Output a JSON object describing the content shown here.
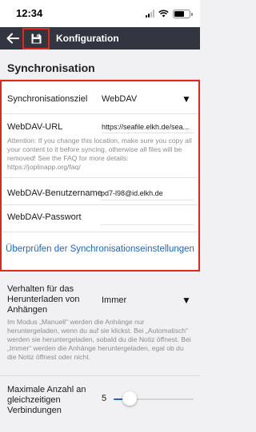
{
  "status_bar": {
    "time": "12:34"
  },
  "header": {
    "title": "Konfiguration",
    "back_icon": "arrow-left-icon",
    "save_icon": "floppy-disk-icon"
  },
  "section": {
    "title": "Synchronisation"
  },
  "sync": {
    "target_label": "Synchronisationsziel",
    "target_value": "WebDAV",
    "url_label": "WebDAV-URL",
    "url_value": "https://seafile.elkh.de/sea...",
    "attention_note": "Attention: If you change this location, make sure you copy all your content to it before syncing, otherwise all files will be removed! See the FAQ for more details: https://joplinapp.org/faq/",
    "username_label": "WebDAV-Benutzername",
    "username_value": "pd7-l98@id.elkh.de",
    "password_label": "WebDAV-Passwort",
    "password_value": "",
    "check_button": "Überprüfen der Synchronisationseinstellungen"
  },
  "attachments": {
    "behavior_label": "Verhalten für das Herunterladen von Anhängen",
    "behavior_value": "Immer",
    "behavior_note": "Im Modus „Manuell“ werden die Anhänge nur heruntergeladen, wenn du auf sie klickst. Bei „Automatisch“ werden sie heruntergeladen, sobald du die Notiz öffnest. Bei „Immer“ werden die Anhänge heruntergeladen, egal ob du die Notiz öffnest oder nicht."
  },
  "concurrency": {
    "label": "Maximale Anzahl an gleichzeitigen Verbindungen",
    "value": "5",
    "level_fraction": 0.2
  },
  "colors": {
    "header_bg": "#313640",
    "accent": "#1f66c4",
    "highlight": "#e3271a",
    "page_bg": "#f1f1f4"
  }
}
